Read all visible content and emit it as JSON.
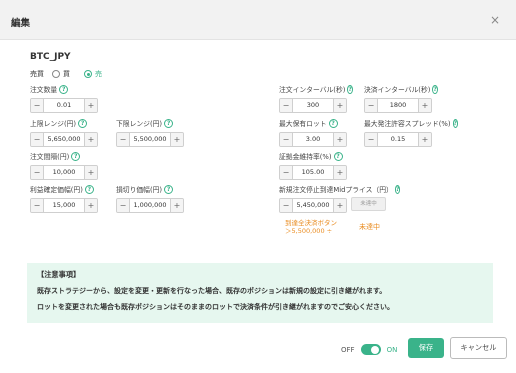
{
  "header": {
    "title": "編集",
    "close": "×"
  },
  "pair": "BTC_JPY",
  "side": {
    "label": "売買",
    "options": [
      "買",
      "売"
    ],
    "selected": 1
  },
  "fields": {
    "order_qty": {
      "label": "注文数量",
      "value": "0.01"
    },
    "upper_range": {
      "label": "上限レンジ(円)",
      "value": "5,650,000"
    },
    "lower_range": {
      "label": "下限レンジ(円)",
      "value": "5,500,000"
    },
    "order_interval": {
      "label": "注文間隔(円)",
      "value": "10,000"
    },
    "take_profit": {
      "label": "利益確定価幅(円)",
      "value": "15,000"
    },
    "stop_loss": {
      "label": "損切り価幅(円)",
      "value": "1,000,000"
    },
    "order_interval_sec": {
      "label": "注文インターバル(秒)",
      "value": "300"
    },
    "settle_interval_sec": {
      "label": "決済インターバル(秒)",
      "value": "1800"
    },
    "max_lot": {
      "label": "最大保有ロット",
      "value": "3.00"
    },
    "max_spread": {
      "label": "最大発注許容スプレッド(%)",
      "value": "0.15"
    },
    "margin_ratio": {
      "label": "証拠金維持率(%)",
      "value": "105.00"
    },
    "stop_mid_price": {
      "label": "新規注文停止到達Midプライス（円）",
      "value": "5,450,000"
    }
  },
  "stop_mid_button": "未達中",
  "settle_note": {
    "line1": "到達全決済ボタン",
    "line2": "＞5,500,000 ÷",
    "status": "未達中"
  },
  "notice": {
    "title": "【注意事項】",
    "line1": "既存ストラテジーから、設定を変更・更新を行なった場合、既存のポジションは新規の設定に引き継がれます。",
    "line2": "ロットを変更された場合も既存ポジションはそのままのロットで決済条件が引き継がれますのでご安心ください。"
  },
  "footer": {
    "off": "OFF",
    "on": "ON",
    "save": "保存",
    "cancel": "キャンセル"
  },
  "colors": {
    "accent": "#3ab38a",
    "warning": "#e98b1f",
    "notice_bg": "#e6f7ef"
  }
}
